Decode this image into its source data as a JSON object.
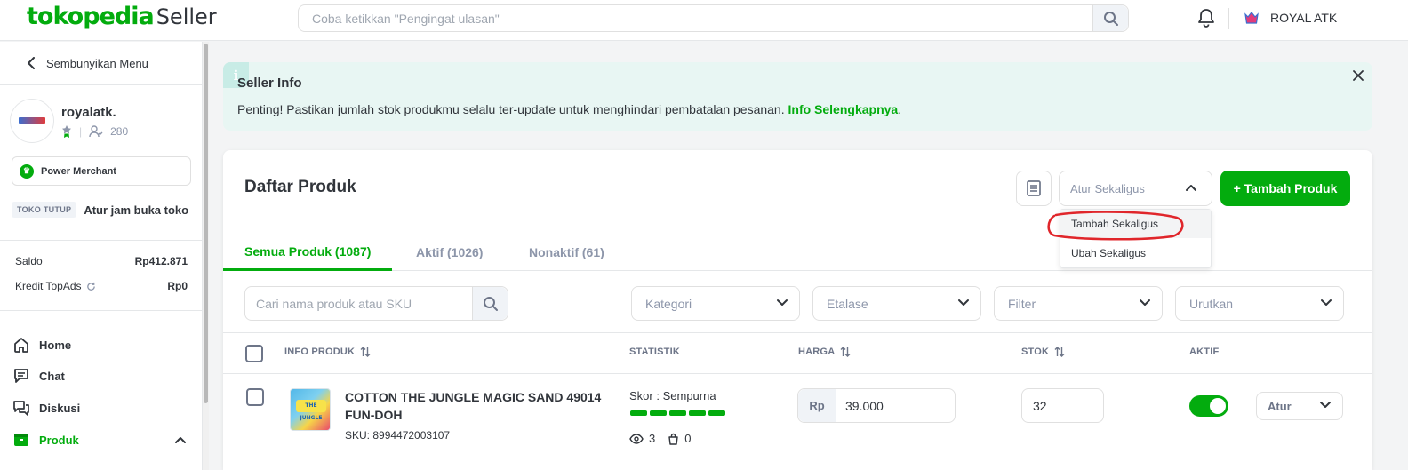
{
  "header": {
    "brand": "tokopedia",
    "product": "Seller",
    "search_placeholder": "Coba ketikkan \"Pengingat ulasan\"",
    "shop_name": "ROYAL ATK"
  },
  "sidebar": {
    "hide_menu_label": "Sembunyikan Menu",
    "shop_name": "royalatk.",
    "followers": "280",
    "badge_label": "Power Merchant",
    "store_status": "TOKO TUTUP",
    "store_hours_link": "Atur jam buka toko",
    "balances": [
      {
        "label": "Saldo",
        "value": "Rp412.871"
      },
      {
        "label": "Kredit TopAds",
        "value": "Rp0"
      }
    ],
    "nav": [
      {
        "label": "Home",
        "icon": "home-icon"
      },
      {
        "label": "Chat",
        "icon": "chat-icon"
      },
      {
        "label": "Diskusi",
        "icon": "discussion-icon"
      },
      {
        "label": "Produk",
        "icon": "box-icon",
        "active": true
      }
    ]
  },
  "info_banner": {
    "title": "Seller Info",
    "text": "Penting! Pastikan jumlah stok produkmu selalu ter-update untuk menghindari pembatalan pesanan.",
    "link": "Info Selengkapnya",
    "link_suffix": "."
  },
  "products": {
    "title": "Daftar Produk",
    "bulk_select": "Atur Sekaligus",
    "bulk_options": [
      "Tambah Sekaligus",
      "Ubah Sekaligus"
    ],
    "add_button": "+ Tambah Produk",
    "tabs": [
      {
        "label": "Semua Produk (1087)",
        "active": true
      },
      {
        "label": "Aktif (1026)",
        "active": false
      },
      {
        "label": "Nonaktif (61)",
        "active": false
      }
    ],
    "search_placeholder": "Cari nama produk atau SKU",
    "filters": [
      "Kategori",
      "Etalase",
      "Filter",
      "Urutkan"
    ],
    "columns": [
      "INFO PRODUK",
      "STATISTIK",
      "HARGA",
      "STOK",
      "AKTIF"
    ],
    "rows": [
      {
        "name": "COTTON THE JUNGLE MAGIC SAND 49014 FUN-DOH",
        "sku": "SKU: 8994472003107",
        "score_label": "Skor :",
        "score_value": "Sempurna",
        "views": "3",
        "wishlist": "0",
        "currency": "Rp",
        "price": "39.000",
        "stock": "32",
        "active": true,
        "action_label": "Atur"
      }
    ]
  },
  "colors": {
    "accent": "#03ac0e",
    "annotation": "#e0262b"
  }
}
